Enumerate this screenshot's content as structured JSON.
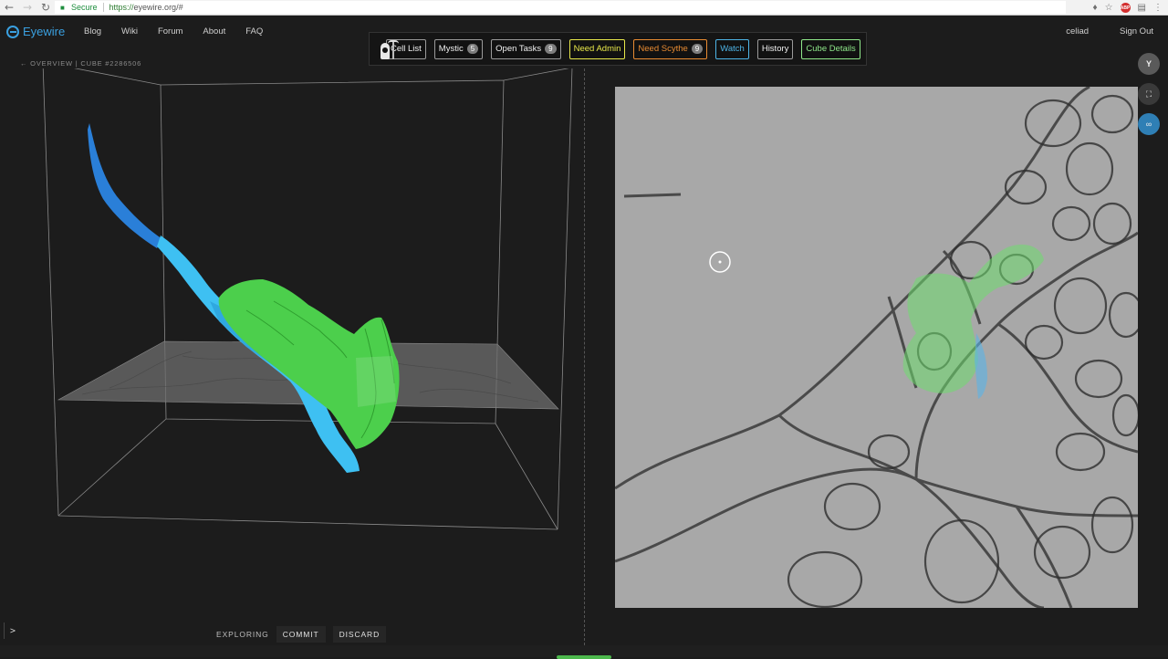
{
  "browser": {
    "secure_label": "Secure",
    "url_scheme": "https://",
    "url_host": "eyewire.org",
    "url_path": "/#",
    "ext_label": "ABP"
  },
  "header": {
    "logo_text": "Eyewire",
    "nav": [
      "Blog",
      "Wiki",
      "Forum",
      "About",
      "FAQ"
    ],
    "username": "celiad",
    "sign_out": "Sign Out"
  },
  "toolbar": {
    "cell_list": "Cell List",
    "mystic": "Mystic",
    "mystic_count": "5",
    "open_tasks": "Open Tasks",
    "open_tasks_count": "9",
    "need_admin": "Need Admin",
    "need_scythe": "Need Scythe",
    "need_scythe_count": "9",
    "watch": "Watch",
    "history": "History",
    "cube_details": "Cube Details"
  },
  "breadcrumb": "← OVERVIEW | CUBE #2286506",
  "side": {
    "y_label": "Y"
  },
  "bottom": {
    "console_prompt": ">",
    "state": "EXPLORING",
    "commit": "COMMIT",
    "discard": "DISCARD"
  },
  "colors": {
    "accent_blue": "#3aa0e0",
    "segment_green": "#4ccf4c",
    "segment_blue": "#38b8f0",
    "need_admin": "#e8e84a",
    "need_scythe": "#e88b32",
    "watch": "#4eb4e6",
    "cube_details": "#8fe88a"
  }
}
